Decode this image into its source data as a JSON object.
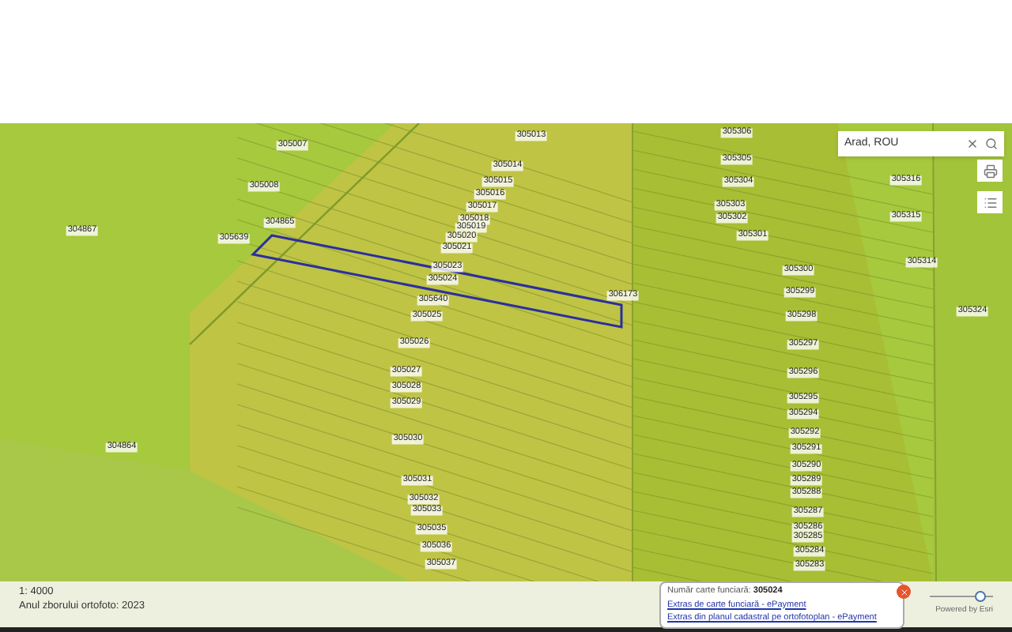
{
  "search": {
    "value": "Arad, ROU"
  },
  "parcels": [
    {
      "label": "305007"
    },
    {
      "label": "305013"
    },
    {
      "label": "305306"
    },
    {
      "label": "305014"
    },
    {
      "label": "305305"
    },
    {
      "label": "305015"
    },
    {
      "label": "305304"
    },
    {
      "label": "305316"
    },
    {
      "label": "305008"
    },
    {
      "label": "305016"
    },
    {
      "label": "305303"
    },
    {
      "label": "305017"
    },
    {
      "label": "305302"
    },
    {
      "label": "305315"
    },
    {
      "label": "304867"
    },
    {
      "label": "304865"
    },
    {
      "label": "305018"
    },
    {
      "label": "305019"
    },
    {
      "label": "305301"
    },
    {
      "label": "305639"
    },
    {
      "label": "305020"
    },
    {
      "label": "305021"
    },
    {
      "label": "305314"
    },
    {
      "label": "305300"
    },
    {
      "label": "305023"
    },
    {
      "label": "305024"
    },
    {
      "label": "306173"
    },
    {
      "label": "305299"
    },
    {
      "label": "305640"
    },
    {
      "label": "305324"
    },
    {
      "label": "305025"
    },
    {
      "label": "305298"
    },
    {
      "label": "305026"
    },
    {
      "label": "305297"
    },
    {
      "label": "305027"
    },
    {
      "label": "305296"
    },
    {
      "label": "305028"
    },
    {
      "label": "305029"
    },
    {
      "label": "305295"
    },
    {
      "label": "305294"
    },
    {
      "label": "304864"
    },
    {
      "label": "305030"
    },
    {
      "label": "305292"
    },
    {
      "label": "305291"
    },
    {
      "label": "305290"
    },
    {
      "label": "305031"
    },
    {
      "label": "305289"
    },
    {
      "label": "305288"
    },
    {
      "label": "305032"
    },
    {
      "label": "305033"
    },
    {
      "label": "305287"
    },
    {
      "label": "305035"
    },
    {
      "label": "305286"
    },
    {
      "label": "305285"
    },
    {
      "label": "305036"
    },
    {
      "label": "305284"
    },
    {
      "label": "305037"
    },
    {
      "label": "305283"
    }
  ],
  "scale": "1: 4000",
  "ortho_year": "Anul zborului ortofoto: 2023",
  "popup": {
    "label": "Număr carte funciară:",
    "number": "305024",
    "links": [
      "Extras de carte funciară - ePayment",
      "Extras din planul cadastral pe ortofotoplan - ePayment"
    ]
  },
  "opacity_slider": {
    "level": 0.8
  },
  "attribution": "Powered by Esri"
}
